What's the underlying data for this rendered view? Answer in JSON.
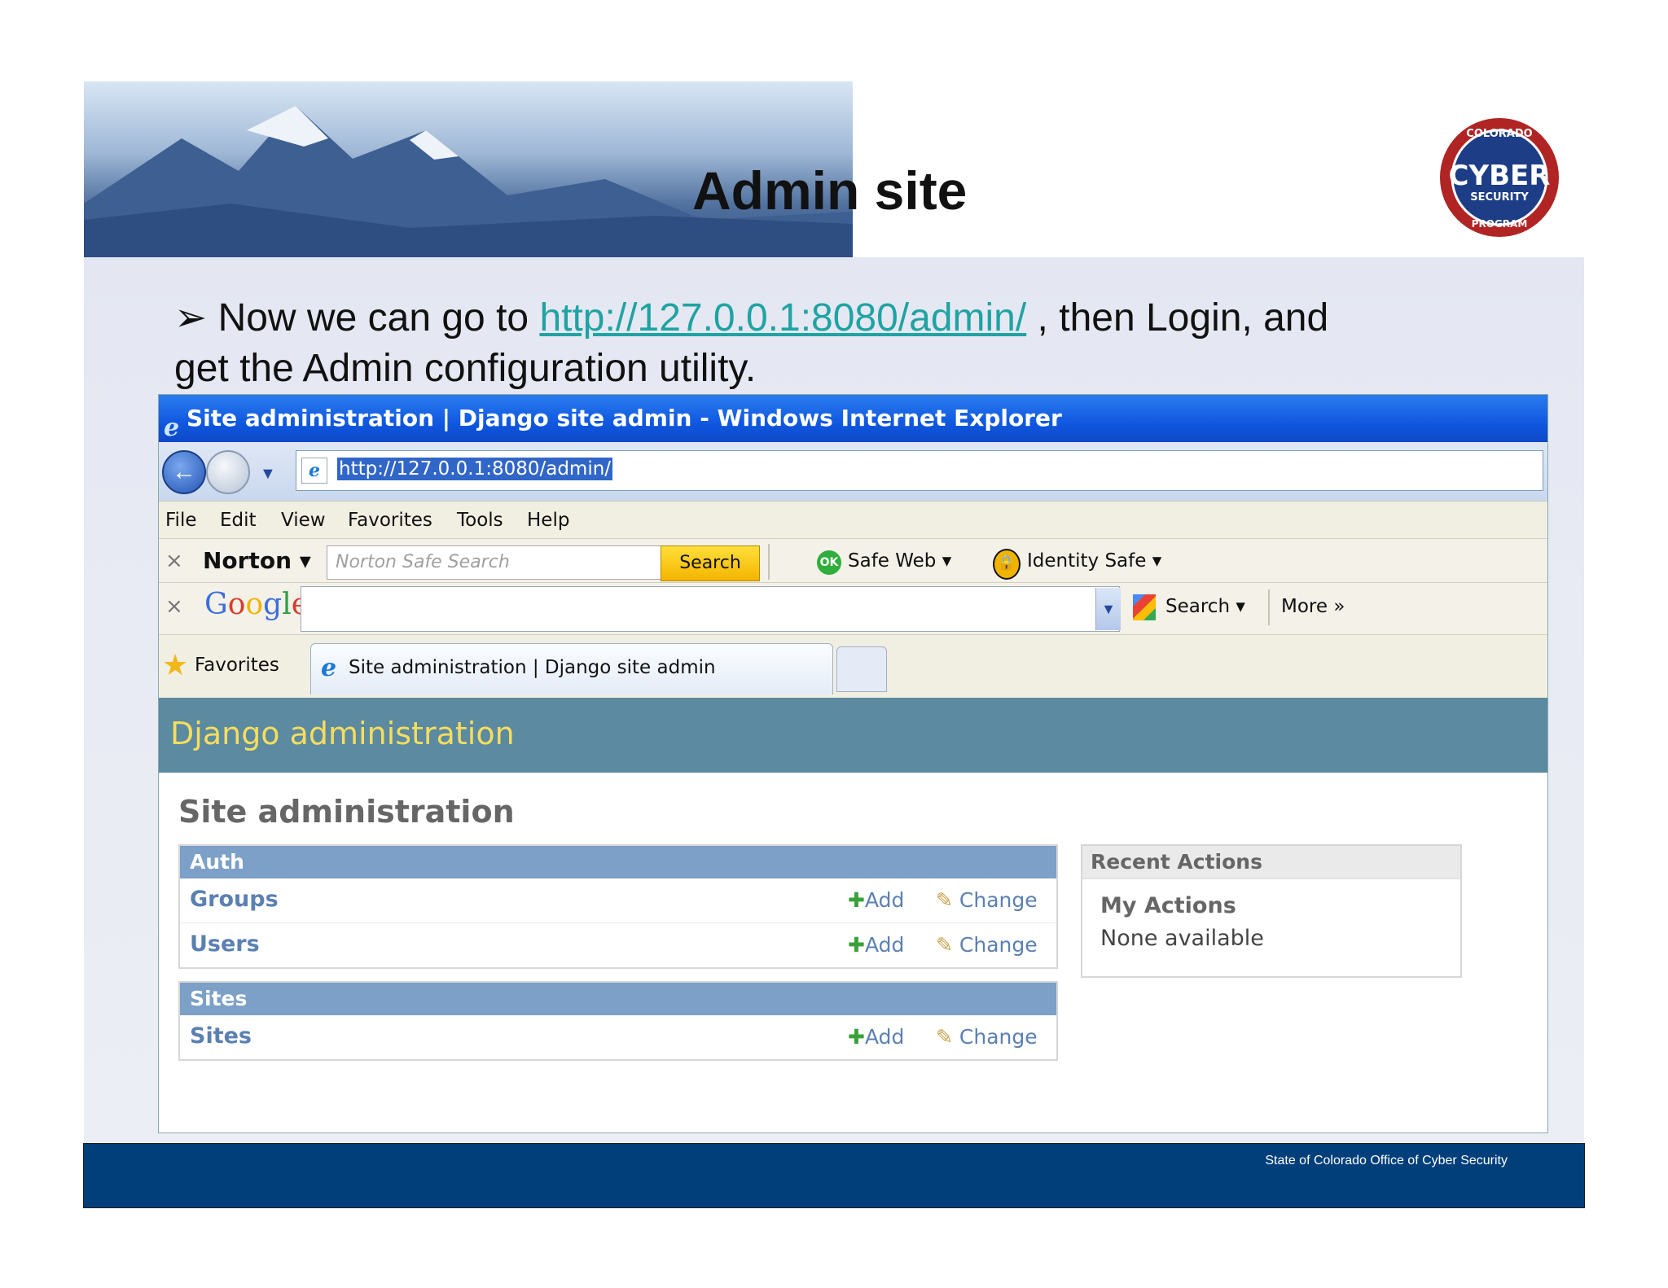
{
  "slide": {
    "title": "Admin site",
    "bullet_prefix": "Now we can go to ",
    "bullet_link": "http://127.0.0.1:8080/admin/",
    "bullet_mid": " , then Login, and",
    "bullet_line2": "get the Admin configuration utility.",
    "footer": "State of Colorado Office of Cyber Security",
    "logo": {
      "top_text": "COLORADO",
      "main_text": "CYBER",
      "sub_text": "SECURITY",
      "bottom_text": "PROGRAM"
    }
  },
  "browser": {
    "window_title": "Site administration | Django site admin - Windows Internet Explorer",
    "address": "http://127.0.0.1:8080/admin/",
    "menu": [
      "File",
      "Edit",
      "View",
      "Favorites",
      "Tools",
      "Help"
    ],
    "norton": {
      "brand": "Norton",
      "search_placeholder": "Norton Safe Search",
      "search_button": "Search",
      "safe_web": "Safe Web",
      "safe_web_badge": "OK",
      "identity_safe": "Identity Safe"
    },
    "google": {
      "brand": "Google",
      "search_label": "Search",
      "more_label": "More"
    },
    "favorites_label": "Favorites",
    "tab_label": "Site administration | Django site admin"
  },
  "django": {
    "header": "Django administration",
    "page_title": "Site administration",
    "modules": [
      {
        "caption": "Auth",
        "rows": [
          {
            "name": "Groups",
            "add": "Add",
            "change": "Change"
          },
          {
            "name": "Users",
            "add": "Add",
            "change": "Change"
          }
        ]
      },
      {
        "caption": "Sites",
        "rows": [
          {
            "name": "Sites",
            "add": "Add",
            "change": "Change"
          }
        ]
      }
    ],
    "recent": {
      "caption": "Recent Actions",
      "my_actions": "My Actions",
      "none": "None available"
    }
  },
  "colors": {
    "django_header": "#5b8aa1",
    "django_header_text": "#f5dd5d",
    "module_caption": "#7ca0c7",
    "link": "#5b80b2",
    "ie_titlebar": "#1058e0",
    "footer": "#003f7a",
    "slide_link": "#1fa3a3"
  }
}
